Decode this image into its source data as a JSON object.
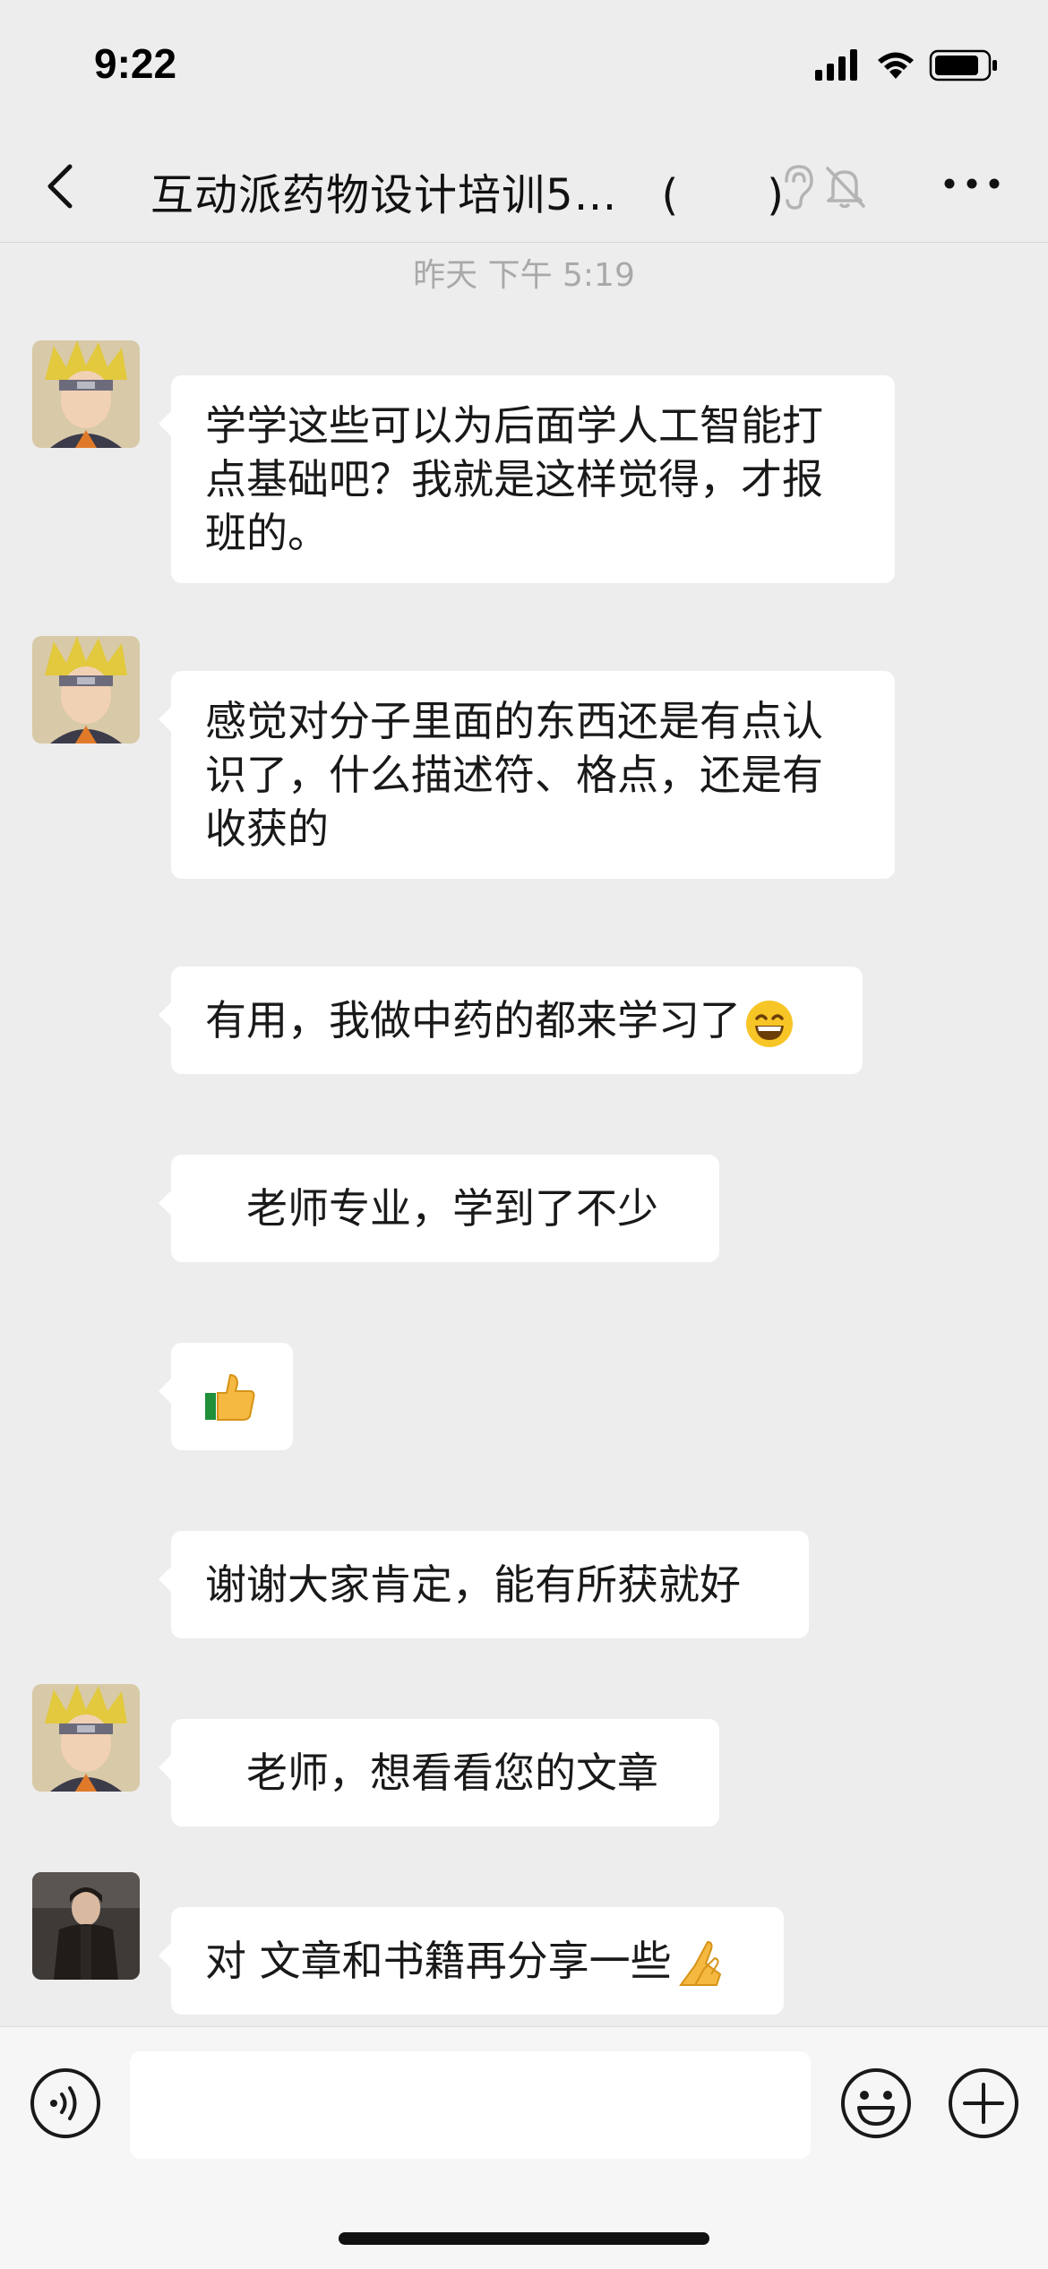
{
  "status_bar": {
    "time": "9:22"
  },
  "header": {
    "title": "互动派药物设计培训5…　(　　)"
  },
  "messages": {
    "timestamp": "昨天 下午 5:19",
    "items": [
      {
        "text": "学学这些可以为后面学人工智能打点基础吧？我就是这样觉得，才报班的。",
        "avatar": "anime-ninja-avatar"
      },
      {
        "text": "感觉对分子里面的东西还是有点认识了，什么描述符、格点，还是有收获的",
        "avatar": "anime-ninja-avatar"
      },
      {
        "text": "有用，我做中药的都来学习了",
        "emoji": "grinning-face"
      },
      {
        "text": "老师专业，学到了不少"
      },
      {
        "emoji": "thumbs-up"
      },
      {
        "text": "谢谢大家肯定，能有所获就好"
      },
      {
        "text": "老师，想看看您的文章",
        "avatar": "anime-ninja-avatar"
      },
      {
        "text": "对 文章和书籍再分享一些",
        "emoji": "folded-hands",
        "avatar": "dark-photo-avatar"
      }
    ]
  },
  "input": {
    "placeholder": ""
  },
  "colors": {
    "background": "#ededed",
    "bubble": "#ffffff",
    "timestamp": "#a9a9a9"
  }
}
